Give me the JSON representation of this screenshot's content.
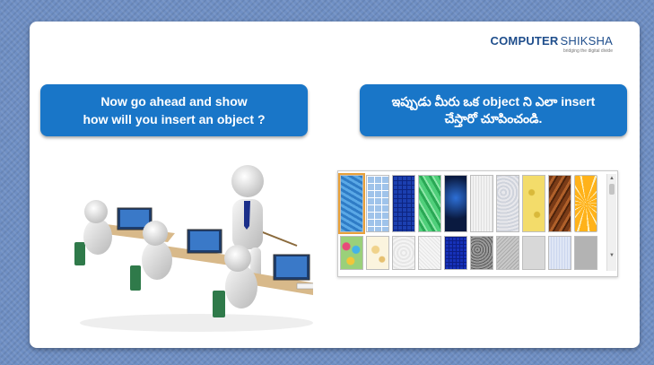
{
  "logo": {
    "title_computer": "COMPUTER",
    "title_shiksha": "SHIKSHA",
    "tagline": "bridging the digital divide",
    "brand_color": "#1f4e8c"
  },
  "callout_left": {
    "line1": "Now go ahead and show",
    "line2": "how will you insert an object ?"
  },
  "callout_right": {
    "line1": "ఇప్పుడు మీరు ఒక object ని ఎలా insert",
    "line2": "చేస్తారో చూపించండి."
  },
  "accent_color": "#1976c8",
  "textures": {
    "row1": [
      "blue-water",
      "blue-tiles",
      "blue-mosaic",
      "green-marble",
      "black-blue",
      "white-paper",
      "gray-stucco",
      "cheese",
      "brown-wood",
      "orange-slice"
    ],
    "row2": [
      "colorful-stones",
      "floral-paper",
      "white-plaster",
      "white-canvas",
      "navy-mosaic",
      "gray-granite",
      "gray-texture",
      "light-gray",
      "pale-blue",
      "gray-solid"
    ]
  },
  "icons": {
    "scroll_up": "▲",
    "scroll_down": "▼"
  }
}
